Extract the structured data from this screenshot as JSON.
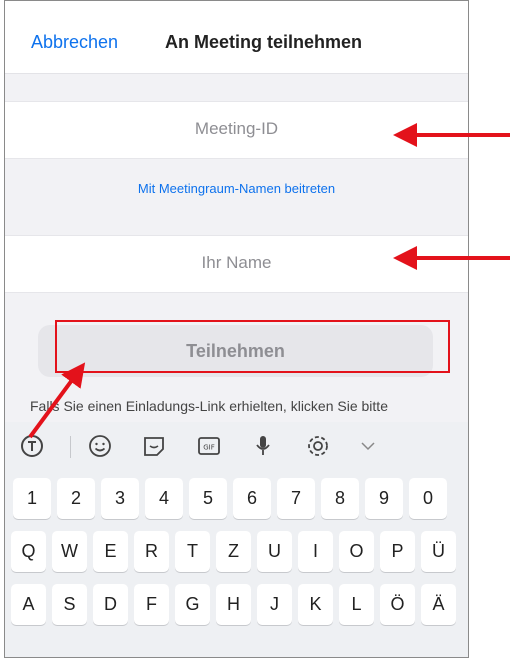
{
  "header": {
    "cancel_label": "Abbrechen",
    "title": "An Meeting teilnehmen"
  },
  "form": {
    "meeting_id_placeholder": "Meeting-ID",
    "room_name_link": "Mit Meetingraum-Namen beitreten",
    "name_placeholder": "Ihr Name",
    "join_label": "Teilnehmen",
    "note": "Falls Sie einen Einladungs-Link erhielten, klicken Sie bitte"
  },
  "keyboard": {
    "toolbar": [
      "translate-icon",
      "emoji-icon",
      "sticker-icon",
      "gif-icon",
      "microphone-icon",
      "settings-icon",
      "chevron-down-icon"
    ],
    "row1": [
      "1",
      "2",
      "3",
      "4",
      "5",
      "6",
      "7",
      "8",
      "9",
      "0"
    ],
    "row2": [
      "Q",
      "W",
      "E",
      "R",
      "T",
      "Z",
      "U",
      "I",
      "O",
      "P",
      "Ü"
    ],
    "row3": [
      "A",
      "S",
      "D",
      "F",
      "G",
      "H",
      "J",
      "K",
      "L",
      "Ö",
      "Ä"
    ]
  },
  "colors": {
    "accent": "#0e72ed",
    "annotation": "#e3121b"
  }
}
